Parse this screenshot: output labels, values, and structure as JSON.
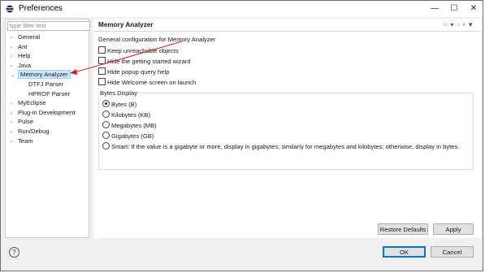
{
  "window": {
    "title": "Preferences",
    "controls": {
      "minimize": "—",
      "maximize": "☐",
      "close": "✕"
    }
  },
  "filter": {
    "placeholder": "type filter text"
  },
  "tree": [
    {
      "label": "General",
      "twisty": "›",
      "child": false,
      "selected": false
    },
    {
      "label": "Ant",
      "twisty": "›",
      "child": false,
      "selected": false
    },
    {
      "label": "Help",
      "twisty": "›",
      "child": false,
      "selected": false
    },
    {
      "label": "Java",
      "twisty": "›",
      "child": false,
      "selected": false
    },
    {
      "label": "Memory Analyzer",
      "twisty": "⌄",
      "child": false,
      "selected": true
    },
    {
      "label": "DTFJ Parser",
      "twisty": "",
      "child": true,
      "selected": false
    },
    {
      "label": "HPROF Parser",
      "twisty": "",
      "child": true,
      "selected": false
    },
    {
      "label": "MyEclipse",
      "twisty": "›",
      "child": false,
      "selected": false
    },
    {
      "label": "Plug-in Development",
      "twisty": "›",
      "child": false,
      "selected": false
    },
    {
      "label": "Pulse",
      "twisty": "›",
      "child": false,
      "selected": false
    },
    {
      "label": "Run/Debug",
      "twisty": "›",
      "child": false,
      "selected": false
    },
    {
      "label": "Team",
      "twisty": "›",
      "child": false,
      "selected": false
    }
  ],
  "page": {
    "title": "Memory Analyzer",
    "description": "General configuration for Memory Analyzer",
    "checkboxes": [
      {
        "label": "Keep unreachable objects",
        "checked": false
      },
      {
        "label": "Hide the getting started wizard",
        "checked": false
      },
      {
        "label": "Hide popup query help",
        "checked": false
      },
      {
        "label": "Hide Welcome screen on launch",
        "checked": false
      }
    ],
    "bytes_display": {
      "label": "Bytes Display",
      "options": [
        {
          "label": "Bytes (B)",
          "selected": true
        },
        {
          "label": "Kilobytes (KB)",
          "selected": false
        },
        {
          "label": "Megabytes (MB)",
          "selected": false
        },
        {
          "label": "Gigabytes (GB)",
          "selected": false
        },
        {
          "label": "Smart: If the value is a gigabyte or more, display in gigabytes; similarly for megabytes and kilobytes; otherwise, display in bytes.",
          "selected": false
        }
      ]
    },
    "restore_defaults_label": "Restore Defaults",
    "apply_label": "Apply"
  },
  "footer": {
    "help_icon": "?",
    "ok_label": "OK",
    "cancel_label": "Cancel"
  },
  "colors": {
    "selection": "#cce8ff",
    "default_button_border": "#0078d7",
    "annotation_arrow": "#d42020"
  }
}
